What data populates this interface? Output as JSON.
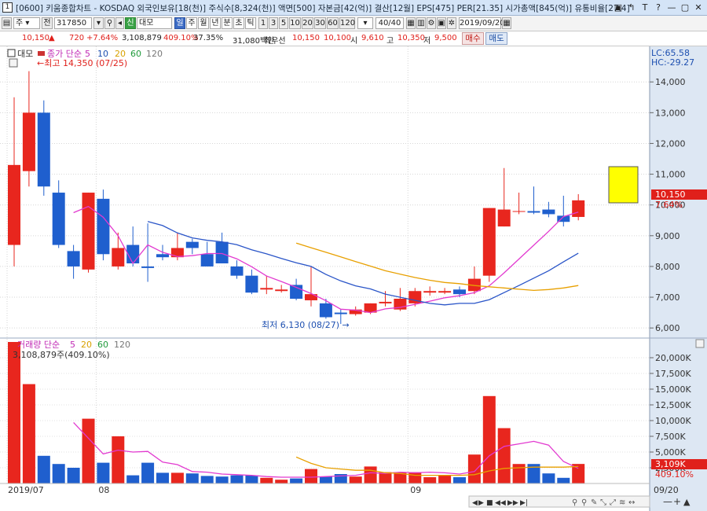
{
  "window": {
    "title": "[0600] 키움종합차트 - KOSDAQ 외국인보유[18(천)] 주식수[8,324(천)] 액면[500] 자본금[42(억)] 결산[12월] EPS[475] PER[21.35] 시가총액[845(억)] 유통비율[27.4]",
    "icon_label": "1",
    "buttons": [
      "▣",
      "↰",
      "T",
      "?",
      "—",
      "▢",
      "✕"
    ]
  },
  "toolbar": {
    "market": "주",
    "all": "전",
    "code": "317850",
    "period_tabs": [
      "일",
      "주",
      "월",
      "년",
      "분",
      "초",
      "틱"
    ],
    "minute_options": [
      "1",
      "3",
      "5",
      "10",
      "20",
      "30",
      "60",
      "120"
    ],
    "tag": "신",
    "name": "대모",
    "count": "40/40",
    "date": "2019/09/20"
  },
  "quote": {
    "price": "10,150",
    "change": "720",
    "change_pct": "+7.64%",
    "volume": "3,108,879",
    "volume_pct": "409.10%",
    "turnover_pct": "37.35%",
    "amount": "31,080백만",
    "best_label": "최우선",
    "best_ask": "10,150",
    "best_bid": "10,100",
    "open_label": "시",
    "open": "9,610",
    "high_label": "고",
    "high": "10,350",
    "low_label": "저",
    "low": "9,500",
    "buy_label": "매수",
    "sell_label": "매도"
  },
  "chart_data": {
    "type": "candlestick",
    "price_legend": {
      "stock": "대모",
      "title": "종가 단순",
      "ma": [
        "5",
        "10",
        "20",
        "60",
        "120"
      ]
    },
    "volume_legend": {
      "title": "거래량 단순",
      "ma": [
        "5",
        "20",
        "60",
        "120"
      ],
      "current": "3,108,879주(409.10%)"
    },
    "y_ticks": [
      6000,
      7000,
      8000,
      9000,
      10000,
      11000,
      12000,
      13000,
      14000
    ],
    "y_tick_labels": [
      "6,000",
      "7,000",
      "8,000",
      "9,000",
      "10,000",
      "11,000",
      "12,000",
      "13,000",
      "14,000"
    ],
    "ylim": [
      5800,
      14900
    ],
    "vol_ticks": [
      2500,
      5000,
      7500,
      10000,
      12500,
      15000,
      17500,
      20000
    ],
    "vol_tick_labels": [
      "2,500K",
      "5,000K",
      "7,500K",
      "10,000K",
      "12,500K",
      "15,000K",
      "17,500K",
      "20,000K"
    ],
    "vol_lim": [
      0,
      22000
    ],
    "x_labels": [
      {
        "i": 0,
        "text": "2019/07"
      },
      {
        "i": 6,
        "text": "08"
      },
      {
        "i": 27,
        "text": "09"
      }
    ],
    "right_bottom_label": "09/20",
    "lc_label": "LC:65.58",
    "hc_label": "HC:-29.27",
    "current_price_label": "10,150",
    "current_change_label": "7.64%",
    "current_vol_label": "3,109K",
    "current_vol_pct_label": "409.10%",
    "high_annotation": "최고 14,350 (07/25)",
    "low_annotation": "최저 6,130 (08/27)",
    "candles": [
      {
        "o": 8700,
        "h": 13500,
        "l": 8000,
        "c": 11300
      },
      {
        "o": 11100,
        "h": 14350,
        "l": 10600,
        "c": 13000
      },
      {
        "o": 13000,
        "h": 13400,
        "l": 10300,
        "c": 10600
      },
      {
        "o": 10400,
        "h": 10800,
        "l": 8600,
        "c": 8700
      },
      {
        "o": 8500,
        "h": 8700,
        "l": 7600,
        "c": 8000
      },
      {
        "o": 7900,
        "h": 10400,
        "l": 7800,
        "c": 10400
      },
      {
        "o": 10200,
        "h": 10500,
        "l": 8200,
        "c": 8400
      },
      {
        "o": 8000,
        "h": 9100,
        "l": 7900,
        "c": 8600
      },
      {
        "o": 8700,
        "h": 9300,
        "l": 8000,
        "c": 8100
      },
      {
        "o": 8000,
        "h": 9400,
        "l": 7500,
        "c": 7950
      },
      {
        "o": 8400,
        "h": 8700,
        "l": 8200,
        "c": 8300
      },
      {
        "o": 8300,
        "h": 9100,
        "l": 8200,
        "c": 8600
      },
      {
        "o": 8800,
        "h": 8900,
        "l": 8400,
        "c": 8600
      },
      {
        "o": 8400,
        "h": 8800,
        "l": 8100,
        "c": 8000
      },
      {
        "o": 8800,
        "h": 9100,
        "l": 8100,
        "c": 8100
      },
      {
        "o": 8000,
        "h": 8200,
        "l": 7600,
        "c": 7700
      },
      {
        "o": 7700,
        "h": 7900,
        "l": 7100,
        "c": 7150
      },
      {
        "o": 7250,
        "h": 7700,
        "l": 7100,
        "c": 7300
      },
      {
        "o": 7200,
        "h": 7400,
        "l": 7150,
        "c": 7250
      },
      {
        "o": 7400,
        "h": 7600,
        "l": 6900,
        "c": 6950
      },
      {
        "o": 6900,
        "h": 8000,
        "l": 6700,
        "c": 7100
      },
      {
        "o": 6800,
        "h": 6950,
        "l": 6300,
        "c": 6350
      },
      {
        "o": 6500,
        "h": 6600,
        "l": 6130,
        "c": 6450
      },
      {
        "o": 6450,
        "h": 6700,
        "l": 6400,
        "c": 6600
      },
      {
        "o": 6500,
        "h": 6800,
        "l": 6450,
        "c": 6800
      },
      {
        "o": 6800,
        "h": 7200,
        "l": 6700,
        "c": 6850
      },
      {
        "o": 6600,
        "h": 7300,
        "l": 6550,
        "c": 6950
      },
      {
        "o": 6800,
        "h": 7300,
        "l": 6700,
        "c": 7200
      },
      {
        "o": 7150,
        "h": 7350,
        "l": 7050,
        "c": 7200
      },
      {
        "o": 7150,
        "h": 7300,
        "l": 7100,
        "c": 7200
      },
      {
        "o": 7250,
        "h": 7350,
        "l": 7000,
        "c": 7100
      },
      {
        "o": 7200,
        "h": 8000,
        "l": 7100,
        "c": 7600
      },
      {
        "o": 7700,
        "h": 9900,
        "l": 7500,
        "c": 9900
      },
      {
        "o": 9300,
        "h": 11200,
        "l": 9300,
        "c": 9850
      },
      {
        "o": 9800,
        "h": 10400,
        "l": 9700,
        "c": 9800
      },
      {
        "o": 9800,
        "h": 10600,
        "l": 9700,
        "c": 9750
      },
      {
        "o": 9850,
        "h": 10100,
        "l": 9600,
        "c": 9700
      },
      {
        "o": 9650,
        "h": 10300,
        "l": 9300,
        "c": 9450
      },
      {
        "o": 9610,
        "h": 10350,
        "l": 9500,
        "c": 10150
      }
    ],
    "volumes": [
      22500,
      15800,
      4400,
      3100,
      2500,
      10300,
      3300,
      7500,
      1300,
      3300,
      1700,
      1700,
      1600,
      1200,
      1100,
      1300,
      1300,
      900,
      600,
      800,
      2300,
      1100,
      1500,
      1100,
      2700,
      1800,
      1800,
      1800,
      1000,
      1300,
      1000,
      4600,
      13900,
      8800,
      3100,
      3100,
      1600,
      900,
      3108
    ],
    "ma5": [
      null,
      null,
      null,
      null,
      9750,
      9950,
      9600,
      9000,
      8100,
      8700,
      8460,
      8320,
      8350,
      8420,
      8420,
      8250,
      7990,
      7690,
      7510,
      7320,
      7120,
      6890,
      6610,
      6580,
      6500,
      6620,
      6670,
      6770,
      6870,
      6980,
      7050,
      7150,
      7370,
      7790,
      8240,
      8690,
      9140,
      9620,
      9770
    ],
    "ma10": [
      null,
      null,
      null,
      null,
      null,
      null,
      null,
      null,
      null,
      9460,
      9330,
      9090,
      8930,
      8850,
      8800,
      8710,
      8540,
      8410,
      8260,
      8120,
      8000,
      7740,
      7530,
      7370,
      7270,
      7100,
      7000,
      6900,
      6800,
      6750,
      6800,
      6800,
      6920,
      7150,
      7380,
      7620,
      7860,
      8150,
      8430
    ],
    "ma20": [
      null,
      null,
      null,
      null,
      null,
      null,
      null,
      null,
      null,
      null,
      null,
      null,
      null,
      null,
      null,
      null,
      null,
      null,
      null,
      8760,
      8610,
      8460,
      8310,
      8160,
      8010,
      7860,
      7750,
      7640,
      7550,
      7480,
      7440,
      7380,
      7340,
      7300,
      7260,
      7220,
      7250,
      7300,
      7380
    ],
    "ma60": [],
    "ma120": [],
    "vol_ma5": [
      null,
      null,
      null,
      null,
      9700,
      7200,
      4700,
      5300,
      5000,
      5100,
      3400,
      3000,
      1900,
      1800,
      1500,
      1400,
      1300,
      1100,
      1000,
      1000,
      1000,
      1100,
      1200,
      1300,
      1700,
      1600,
      1800,
      1700,
      1800,
      1700,
      1500,
      1900,
      4400,
      5900,
      6300,
      6700,
      6100,
      3500,
      2400
    ],
    "vol_ma20": [
      null,
      null,
      null,
      null,
      null,
      null,
      null,
      null,
      null,
      null,
      null,
      null,
      null,
      null,
      null,
      null,
      null,
      null,
      null,
      4200,
      3200,
      2500,
      2300,
      2100,
      2100,
      1700,
      1600,
      1300,
      1300,
      1300,
      1300,
      1400,
      2000,
      2400,
      2500,
      2600,
      2600,
      2600,
      2700
    ]
  },
  "bottom_nav": [
    "◀",
    "▶",
    "■",
    "◀◀",
    "▶▶",
    "▶|"
  ],
  "bottom_tools": [
    "⚲",
    "⚲",
    "✎",
    "⤡",
    "⤢",
    "≋",
    "↔",
    "—",
    "+",
    "▲"
  ]
}
